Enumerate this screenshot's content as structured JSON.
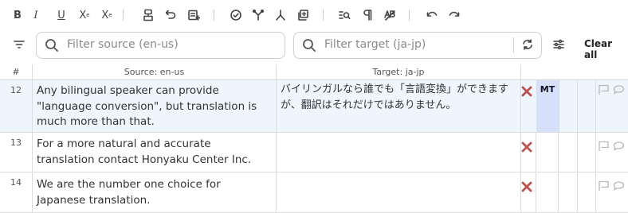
{
  "toolbar": {
    "bold": "B",
    "italic": "I",
    "underline": "U",
    "subscript": "X",
    "subscript_mark": "e",
    "superscript": "X",
    "superscript_mark": "e"
  },
  "filters": {
    "source_placeholder": "Filter source (en-us)",
    "target_placeholder": "Filter target (ja-jp)",
    "clear_all": "Clear all"
  },
  "columns": {
    "number": "#",
    "source": "Source: en-us",
    "target": "Target: ja-jp"
  },
  "rows": [
    {
      "number": "12",
      "source": "Any bilingual speaker can provide \"language conversion\", but translation is much more than that.",
      "target": "バイリンガルなら誰でも「言語変換」ができますが、翻訳はそれだけではありません。",
      "status": "MT"
    },
    {
      "number": "13",
      "source": "For a more natural and accurate translation contact Honyaku Center Inc.",
      "target": "",
      "status": ""
    },
    {
      "number": "14",
      "source": "We are the number one choice for Japanese translation.",
      "target": "",
      "status": ""
    }
  ]
}
